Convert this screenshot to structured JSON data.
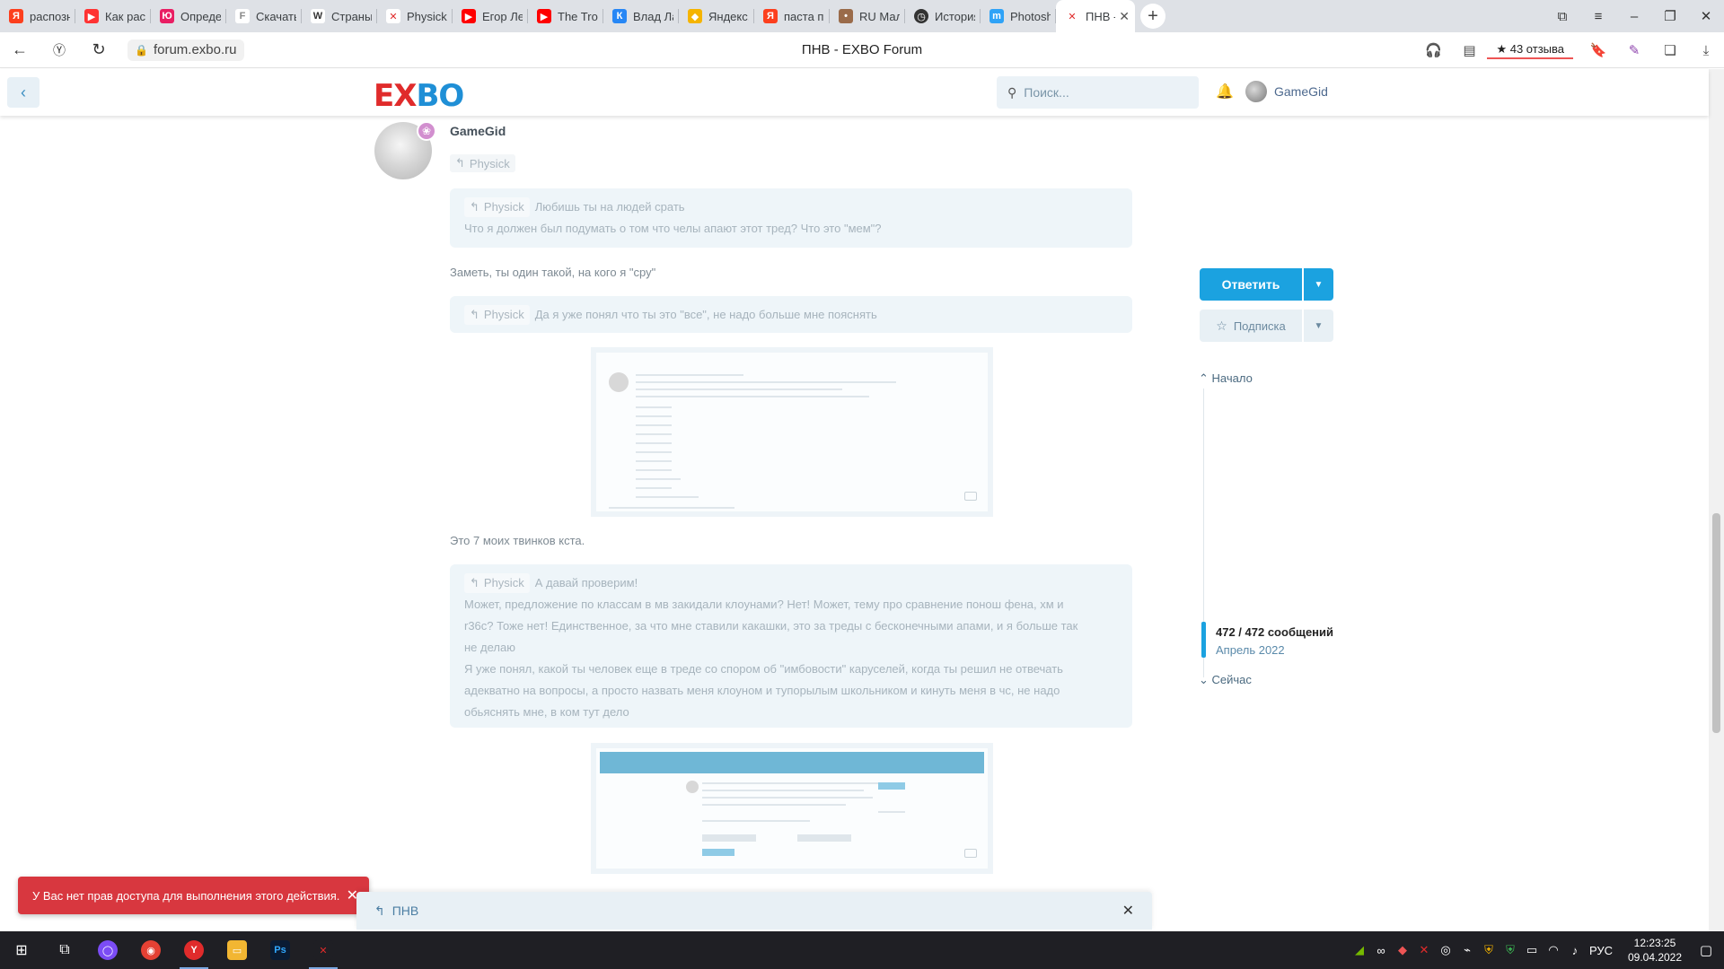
{
  "browser": {
    "tabs": [
      {
        "label": "распознав",
        "icon": "yandex-icon",
        "color": "#fc3f1d"
      },
      {
        "label": "Как распо",
        "icon": "video-icon",
        "color": "#f33"
      },
      {
        "label": "Определи",
        "icon": "yo-icon",
        "color": "#e91e63"
      },
      {
        "label": "Скачать ш",
        "icon": "font-icon",
        "color": "#888"
      },
      {
        "label": "Страны «с",
        "icon": "wikipedia-icon",
        "color": "#333"
      },
      {
        "label": "Physick - E",
        "icon": "exbo-icon",
        "color": "#e02b2b"
      },
      {
        "label": "Егор Лето",
        "icon": "youtube-icon",
        "color": "#f00"
      },
      {
        "label": "The Trollge",
        "icon": "youtube-icon",
        "color": "#f00"
      },
      {
        "label": "Влад Ларк",
        "icon": "vk-icon",
        "color": "#2787f5"
      },
      {
        "label": "Яндекс.Ка",
        "icon": "maps-icon",
        "color": "#f5b400"
      },
      {
        "label": "паста про",
        "icon": "yandex-icon",
        "color": "#fc3f1d"
      },
      {
        "label": "RU Мальчи",
        "icon": "avatar-icon",
        "color": "#9a6b4a"
      },
      {
        "label": "История",
        "icon": "history-icon",
        "color": "#333"
      },
      {
        "label": "Photoshop",
        "icon": "photoshop-icon",
        "color": "#2fa3f7"
      }
    ],
    "active_tab": {
      "label": "ПНВ - E",
      "icon": "exbo-icon"
    },
    "url": "forum.exbo.ru",
    "page_title": "ПНВ - EXBO Forum",
    "reviews": "★ 43 отзыва"
  },
  "header": {
    "logo_e": "E",
    "logo_x": "X",
    "logo_bo": "BO",
    "search_placeholder": "Поиск...",
    "username": "GameGid"
  },
  "post": {
    "author": "GameGid",
    "reply_to": "Physick",
    "quotes": [
      {
        "name": "Physick",
        "head": "Любишь ты на людей срать",
        "lines": [
          "Что я должен был подумать о том что челы апают этот тред? Что это \"мем\"?"
        ]
      },
      {
        "name": "Physick",
        "head": "Да я уже понял что ты это \"все\", не надо больше мне пояснять",
        "lines": []
      },
      {
        "name": "Physick",
        "head": "А давай проверим!",
        "lines": [
          "Может, предложение по классам в мв закидали клоунами? Нет! Может, тему про сравнение понош фена, хм и",
          "r36c? Тоже нет! Единственное, за что мне ставили какашки, это за треды с бесконечными апами, и я больше так",
          "не делаю",
          "Я уже понял, какой ты человек еще в треде со спором об \"имбовости\" каруселей, когда ты решил не отвечать",
          "адекватно на вопросы, а просто назвать меня клоуном и тупорылым школьником и кинуть меня в чс, не надо",
          "обьяснять мне, в ком тут дело"
        ]
      }
    ],
    "text1": "Заметь, ты один такой, на кого я \"сру\"",
    "text2": "Это 7 моих твинков кста."
  },
  "sidebar": {
    "reply_label": "Ответить",
    "subscribe_label": "Подписка",
    "start_label": "Начало",
    "count": "472 / 472 сообщений",
    "date": "Апрель 2022",
    "now_label": "Сейчас"
  },
  "toast": {
    "text": "У Вас нет прав доступа для выполнения этого действия."
  },
  "composer": {
    "title": "ПНВ"
  },
  "taskbar": {
    "lang": "РУС",
    "time": "12:23:25",
    "date": "09.04.2022"
  }
}
